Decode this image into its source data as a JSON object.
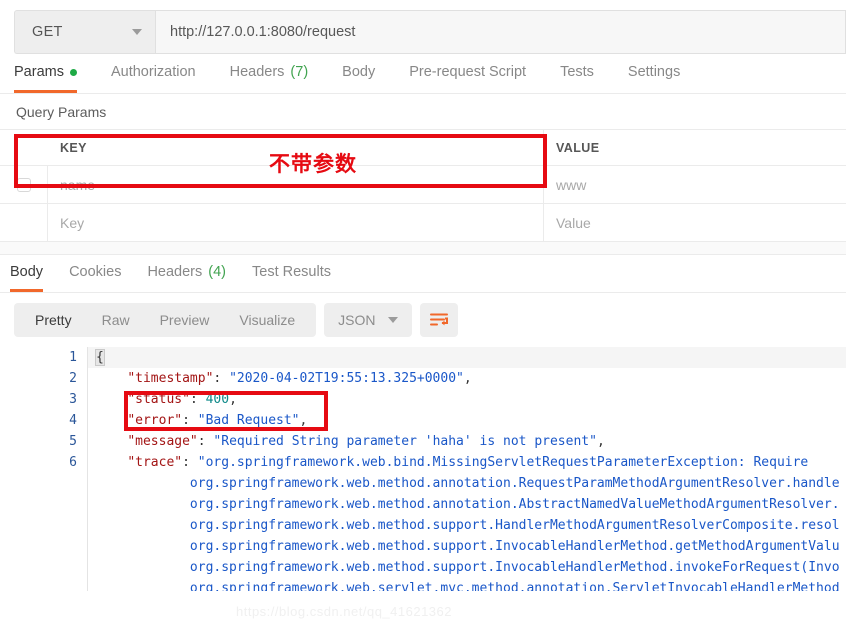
{
  "request": {
    "method": "GET",
    "method_caret": "chevron-down-icon",
    "url": "http://127.0.0.1:8080/request",
    "tabs": [
      {
        "label": "Params",
        "badge": "",
        "dot": true,
        "active": true
      },
      {
        "label": "Authorization",
        "badge": "",
        "dot": false,
        "active": false
      },
      {
        "label": "Headers",
        "badge": "(7)",
        "dot": false,
        "active": false
      },
      {
        "label": "Body",
        "badge": "",
        "dot": false,
        "active": false
      },
      {
        "label": "Pre-request Script",
        "badge": "",
        "dot": false,
        "active": false
      },
      {
        "label": "Tests",
        "badge": "",
        "dot": false,
        "active": false
      },
      {
        "label": "Settings",
        "badge": "",
        "dot": false,
        "active": false
      }
    ]
  },
  "params": {
    "section_title": "Query Params",
    "columns": {
      "key": "KEY",
      "value": "VALUE"
    },
    "rows": [
      {
        "checked": false,
        "key_placeholder": "name",
        "value_placeholder": "www"
      },
      {
        "checked": false,
        "key_placeholder": "Key",
        "value_placeholder": "Value"
      }
    ],
    "annotation": {
      "text": "不带参数",
      "color": "#e60a12"
    }
  },
  "response": {
    "tabs": [
      {
        "label": "Body",
        "badge": "",
        "active": true
      },
      {
        "label": "Cookies",
        "badge": "",
        "active": false
      },
      {
        "label": "Headers",
        "badge": "(4)",
        "active": false
      },
      {
        "label": "Test Results",
        "badge": "",
        "active": false
      }
    ],
    "view_modes": [
      {
        "label": "Pretty",
        "active": true
      },
      {
        "label": "Raw",
        "active": false
      },
      {
        "label": "Preview",
        "active": false
      },
      {
        "label": "Visualize",
        "active": false
      }
    ],
    "format": "JSON",
    "format_caret": "chevron-down-icon",
    "wrap_icon": "word-wrap-icon",
    "wrap_icon_color": "#f1682b",
    "line_numbers": [
      "1",
      "2",
      "3",
      "4",
      "5",
      "6"
    ],
    "body_lines": [
      {
        "indent": 0,
        "tokens": [
          {
            "t": "{",
            "c": "brace"
          }
        ]
      },
      {
        "indent": 1,
        "tokens": [
          {
            "t": "\"timestamp\"",
            "c": "k"
          },
          {
            "t": ": ",
            "c": "p"
          },
          {
            "t": "\"2020-04-02T19:55:13.325+0000\"",
            "c": "s"
          },
          {
            "t": ",",
            "c": "p"
          }
        ]
      },
      {
        "indent": 1,
        "tokens": [
          {
            "t": "\"status\"",
            "c": "k"
          },
          {
            "t": ": ",
            "c": "p"
          },
          {
            "t": "400",
            "c": "n"
          },
          {
            "t": ",",
            "c": "p"
          }
        ]
      },
      {
        "indent": 1,
        "tokens": [
          {
            "t": "\"error\"",
            "c": "k"
          },
          {
            "t": ": ",
            "c": "p"
          },
          {
            "t": "\"Bad Request\"",
            "c": "s"
          },
          {
            "t": ",",
            "c": "p"
          }
        ]
      },
      {
        "indent": 1,
        "tokens": [
          {
            "t": "\"message\"",
            "c": "k"
          },
          {
            "t": ": ",
            "c": "p"
          },
          {
            "t": "\"Required String parameter 'haha' is not present\"",
            "c": "s"
          },
          {
            "t": ",",
            "c": "p"
          }
        ]
      },
      {
        "indent": 1,
        "tokens": [
          {
            "t": "\"trace\"",
            "c": "k"
          },
          {
            "t": ": ",
            "c": "p"
          },
          {
            "t": "\"org.springframework.web.bind.MissingServletRequestParameterException: Require",
            "c": "s"
          }
        ]
      },
      {
        "indent": 3,
        "tokens": [
          {
            "t": "org.springframework.web.method.annotation.RequestParamMethodArgumentResolver.handle",
            "c": "s"
          }
        ]
      },
      {
        "indent": 3,
        "tokens": [
          {
            "t": "org.springframework.web.method.annotation.AbstractNamedValueMethodArgumentResolver.",
            "c": "s"
          }
        ]
      },
      {
        "indent": 3,
        "tokens": [
          {
            "t": "org.springframework.web.method.support.HandlerMethodArgumentResolverComposite.resol",
            "c": "s"
          }
        ]
      },
      {
        "indent": 3,
        "tokens": [
          {
            "t": "org.springframework.web.method.support.InvocableHandlerMethod.getMethodArgumentValu",
            "c": "s"
          }
        ]
      },
      {
        "indent": 3,
        "tokens": [
          {
            "t": "org.springframework.web.method.support.InvocableHandlerMethod.invokeForRequest(Invo",
            "c": "s"
          }
        ]
      },
      {
        "indent": 3,
        "tokens": [
          {
            "t": "org.springframework.web.servlet.mvc.method.annotation.ServletInvocableHandlerMethod",
            "c": "s"
          }
        ]
      }
    ],
    "annotation": {
      "color": "#e60a12"
    },
    "watermark": "https://blog.csdn.net/qq_41621362"
  }
}
